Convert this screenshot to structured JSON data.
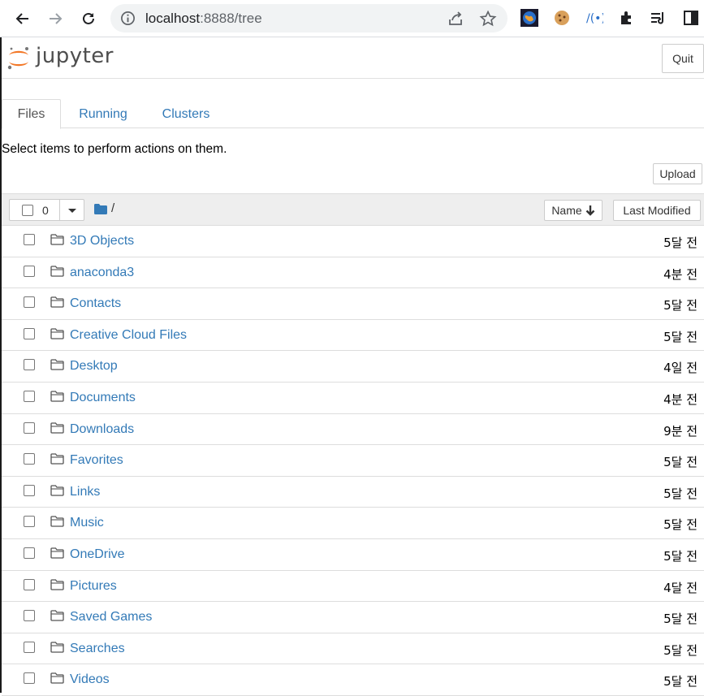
{
  "browser": {
    "url_host": "localhost",
    "url_port_path": ":8888/tree"
  },
  "header": {
    "logo_text": "jupyter",
    "quit_label": "Quit"
  },
  "tabs": [
    {
      "label": "Files",
      "active": true
    },
    {
      "label": "Running",
      "active": false
    },
    {
      "label": "Clusters",
      "active": false
    }
  ],
  "hint": "Select items to perform actions on them.",
  "upload_label": "Upload",
  "list_header": {
    "selected_count": "0",
    "root_path": "/",
    "name_sort_label": "Name",
    "modified_label": "Last Modified"
  },
  "colors": {
    "link": "#337ab7",
    "jupyter_orange": "#f37726"
  },
  "files": [
    {
      "name": "3D Objects",
      "modified": "5달 전"
    },
    {
      "name": "anaconda3",
      "modified": "4분 전"
    },
    {
      "name": "Contacts",
      "modified": "5달 전"
    },
    {
      "name": "Creative Cloud Files",
      "modified": "5달 전"
    },
    {
      "name": "Desktop",
      "modified": "4일 전"
    },
    {
      "name": "Documents",
      "modified": "4분 전"
    },
    {
      "name": "Downloads",
      "modified": "9분 전"
    },
    {
      "name": "Favorites",
      "modified": "5달 전"
    },
    {
      "name": "Links",
      "modified": "5달 전"
    },
    {
      "name": "Music",
      "modified": "5달 전"
    },
    {
      "name": "OneDrive",
      "modified": "5달 전"
    },
    {
      "name": "Pictures",
      "modified": "4달 전"
    },
    {
      "name": "Saved Games",
      "modified": "5달 전"
    },
    {
      "name": "Searches",
      "modified": "5달 전"
    },
    {
      "name": "Videos",
      "modified": "5달 전"
    }
  ]
}
